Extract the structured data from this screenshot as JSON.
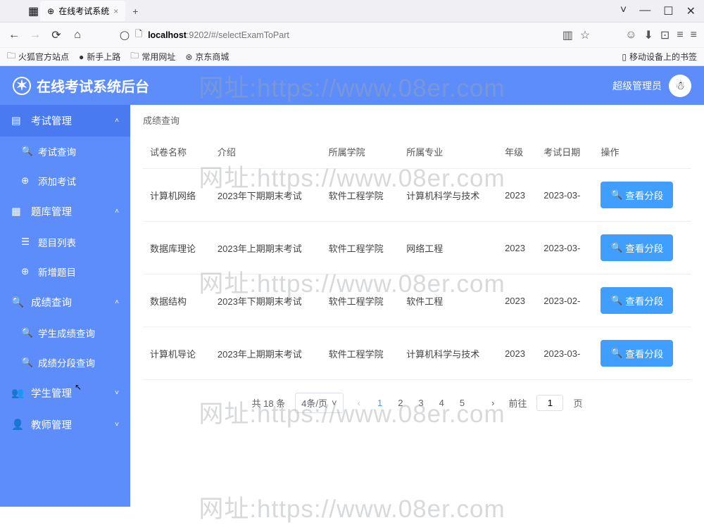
{
  "browser": {
    "tab_title": "在线考试系统",
    "url_host": "localhost",
    "url_port": ":9202",
    "url_path": "/#/selectExamToPart",
    "bookmarks": [
      "火狐官方站点",
      "新手上路",
      "常用网址",
      "京东商城"
    ],
    "bookmark_right": "移动设备上的书签"
  },
  "header": {
    "title": "在线考试系统后台",
    "user_role": "超级管理员"
  },
  "watermark": "网址:https://www.08er.com",
  "sidebar": {
    "groups": [
      {
        "label": "考试管理",
        "open": true,
        "items": [
          "考试查询",
          "添加考试"
        ]
      },
      {
        "label": "题库管理",
        "open": true,
        "items": [
          "题目列表",
          "新增题目"
        ]
      },
      {
        "label": "成绩查询",
        "open": true,
        "items": [
          "学生成绩查询",
          "成绩分段查询"
        ]
      },
      {
        "label": "学生管理",
        "open": false,
        "items": []
      },
      {
        "label": "教师管理",
        "open": false,
        "items": []
      }
    ]
  },
  "breadcrumb": "成绩查询",
  "table": {
    "headers": [
      "试卷名称",
      "介绍",
      "所属学院",
      "所属专业",
      "年级",
      "考试日期",
      "操作"
    ],
    "rows": [
      {
        "name": "计算机网络",
        "intro": "2023年下期期末考试",
        "college": "软件工程学院",
        "major": "计算机科学与技术",
        "grade": "2023",
        "date": "2023-03-"
      },
      {
        "name": "数据库理论",
        "intro": "2023年上期期末考试",
        "college": "软件工程学院",
        "major": "网络工程",
        "grade": "2023",
        "date": "2023-03-"
      },
      {
        "name": "数据结构",
        "intro": "2023年下期期末考试",
        "college": "软件工程学院",
        "major": "软件工程",
        "grade": "2023",
        "date": "2023-02-"
      },
      {
        "name": "计算机导论",
        "intro": "2023年上期期末考试",
        "college": "软件工程学院",
        "major": "计算机科学与技术",
        "grade": "2023",
        "date": "2023-03-"
      }
    ],
    "action_label": "查看分段"
  },
  "pagination": {
    "total_text": "共 18 条",
    "page_size": "4条/页",
    "pages": [
      "1",
      "2",
      "3",
      "4",
      "5"
    ],
    "active": 1,
    "jump_prefix": "前往",
    "jump_value": "1",
    "jump_suffix": "页"
  }
}
